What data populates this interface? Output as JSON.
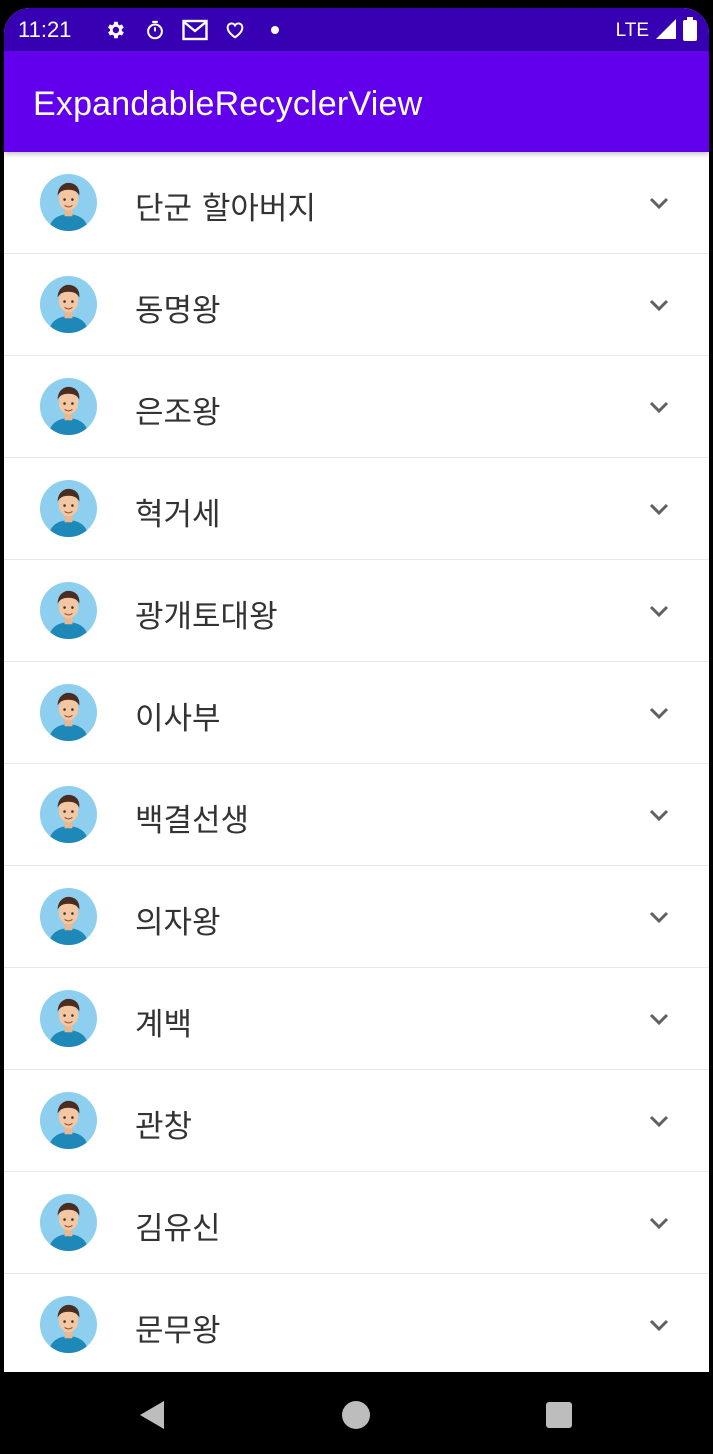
{
  "status_bar": {
    "time": "11:21",
    "network_label": "LTE",
    "icons": [
      "gear-icon",
      "stopwatch-icon",
      "mail-icon",
      "heart-icon",
      "dot-icon",
      "signal-icon",
      "battery-icon"
    ]
  },
  "app_bar": {
    "title": "ExpandableRecyclerView"
  },
  "list": {
    "items": [
      {
        "label": "단군 할아버지"
      },
      {
        "label": "동명왕"
      },
      {
        "label": "은조왕"
      },
      {
        "label": "혁거세"
      },
      {
        "label": "광개토대왕"
      },
      {
        "label": "이사부"
      },
      {
        "label": "백결선생"
      },
      {
        "label": "의자왕"
      },
      {
        "label": "계백"
      },
      {
        "label": "관창"
      },
      {
        "label": "김유신"
      },
      {
        "label": "문무왕"
      }
    ],
    "item_icon": "chevron-down-icon",
    "avatar_icon": "person-avatar-icon"
  },
  "colors": {
    "status_bar": "#3700b3",
    "app_bar": "#6200ee",
    "avatar_bg": "#8ecff0",
    "shirt": "#1e88b8"
  },
  "nav_bar": {
    "buttons": [
      "back-icon",
      "home-icon",
      "recents-icon"
    ]
  }
}
